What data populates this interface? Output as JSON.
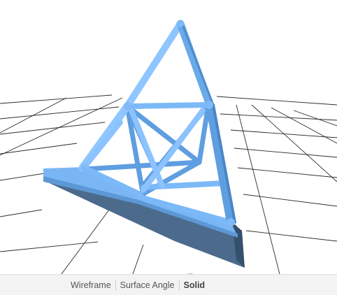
{
  "viewer": {
    "model": "tetrahedral-truss",
    "render_mode": "Solid",
    "colors": {
      "beam_light": "#8ec4ff",
      "beam_mid": "#6aa9ec",
      "beam_dark": "#4a86c6",
      "shadow": "#4c6b8c",
      "grid": "#2b2b2b"
    }
  },
  "toolbar": {
    "modes": [
      {
        "label": "Wireframe",
        "active": false
      },
      {
        "label": "Surface Angle",
        "active": false
      },
      {
        "label": "Solid",
        "active": true
      }
    ]
  }
}
